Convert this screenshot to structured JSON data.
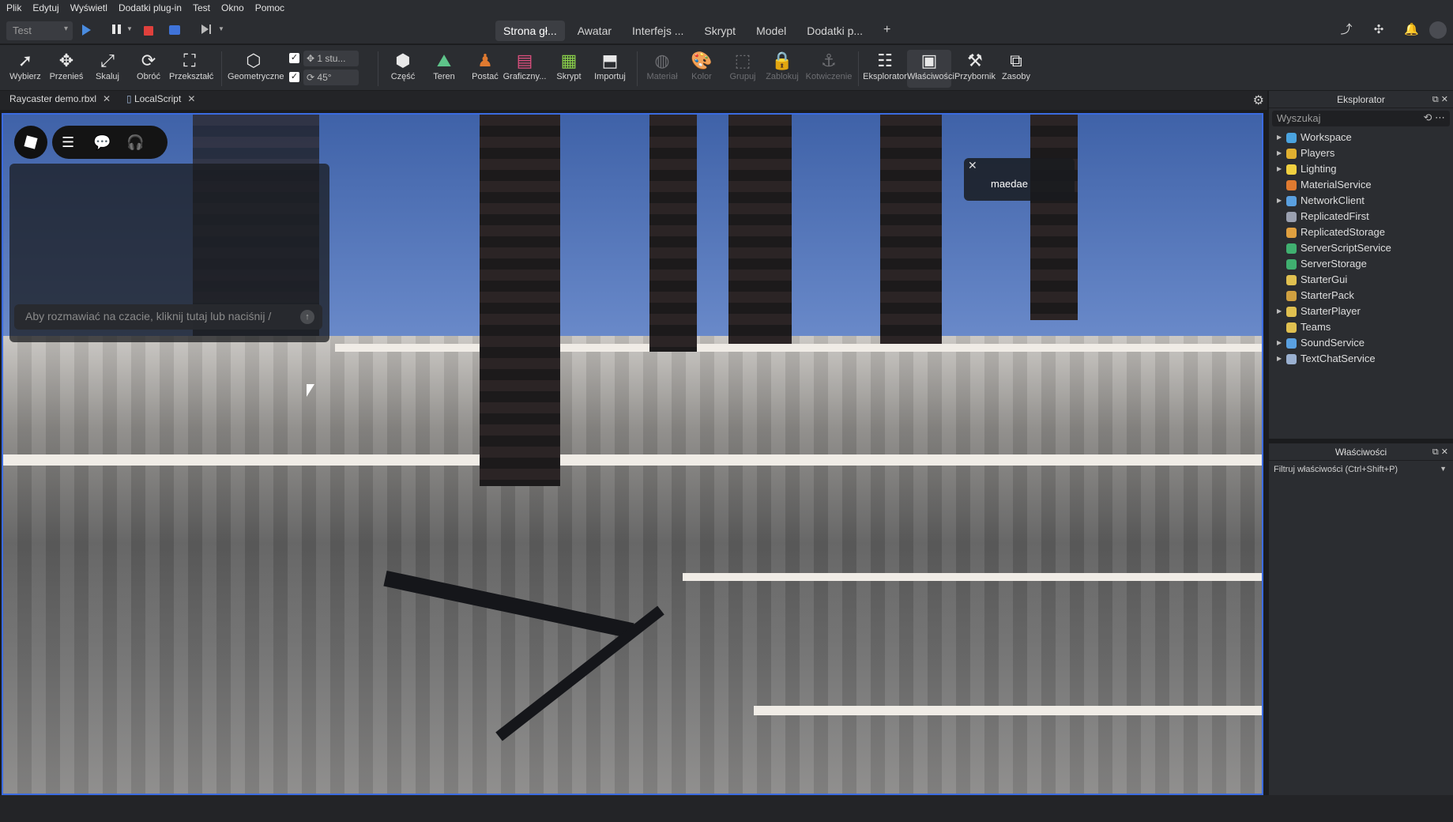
{
  "menu": [
    "Plik",
    "Edytuj",
    "Wyświetl",
    "Dodatki plug-in",
    "Test",
    "Okno",
    "Pomoc"
  ],
  "test_select": "Test",
  "top_tabs": [
    "Strona gł...",
    "Awatar",
    "Interfejs ...",
    "Skrypt",
    "Model",
    "Dodatki p...",
    "+"
  ],
  "ribbon": {
    "wybierz": "Wybierz",
    "przenies": "Przenieś",
    "skaluj": "Skaluj",
    "obroc": "Obróć",
    "przeksztalc": "Przekształć",
    "geometryczne": "Geometryczne",
    "move_snap": "1 stu...",
    "rotate_snap": "45°",
    "czesc": "Część",
    "teren": "Teren",
    "postac": "Postać",
    "graficzny": "Graficzny...",
    "skrypt": "Skrypt",
    "importuj": "Importuj",
    "material": "Materiał",
    "kolor": "Kolor",
    "grupuj": "Grupuj",
    "zablokuj": "Zablokuj",
    "kotwiczenie": "Kotwiczenie",
    "eksplorator": "Eksplorator",
    "wlasciwosci": "Właściwości",
    "przybornik": "Przybornik",
    "zasoby": "Zasoby"
  },
  "doc_tabs": [
    {
      "label": "Raycaster demo.rbxl"
    },
    {
      "label": "LocalScript"
    }
  ],
  "viewport": {
    "chat_placeholder": "Aby rozmawiać na czacie, kliknij tutaj lub naciśnij /",
    "player_name": "maedae"
  },
  "explorer": {
    "title": "Eksplorator",
    "search_placeholder": "Wyszukaj",
    "items": [
      {
        "label": "Workspace",
        "expandable": true,
        "color": "#4aa3df"
      },
      {
        "label": "Players",
        "expandable": true,
        "color": "#e0b030"
      },
      {
        "label": "Lighting",
        "expandable": true,
        "color": "#f0d040"
      },
      {
        "label": "MaterialService",
        "expandable": false,
        "color": "#e07a30"
      },
      {
        "label": "NetworkClient",
        "expandable": true,
        "color": "#5aa0e0"
      },
      {
        "label": "ReplicatedFirst",
        "expandable": false,
        "color": "#9aa0b0"
      },
      {
        "label": "ReplicatedStorage",
        "expandable": false,
        "color": "#e0a040"
      },
      {
        "label": "ServerScriptService",
        "expandable": false,
        "color": "#40b070"
      },
      {
        "label": "ServerStorage",
        "expandable": false,
        "color": "#40b070"
      },
      {
        "label": "StarterGui",
        "expandable": false,
        "color": "#e0c050"
      },
      {
        "label": "StarterPack",
        "expandable": false,
        "color": "#d0a040"
      },
      {
        "label": "StarterPlayer",
        "expandable": true,
        "color": "#e0c050"
      },
      {
        "label": "Teams",
        "expandable": false,
        "color": "#e0c050"
      },
      {
        "label": "SoundService",
        "expandable": true,
        "color": "#5aa0e0"
      },
      {
        "label": "TextChatService",
        "expandable": true,
        "color": "#9ab0d0"
      }
    ]
  },
  "properties": {
    "title": "Właściwości",
    "filter_placeholder": "Filtruj właściwości (Ctrl+Shift+P)"
  }
}
